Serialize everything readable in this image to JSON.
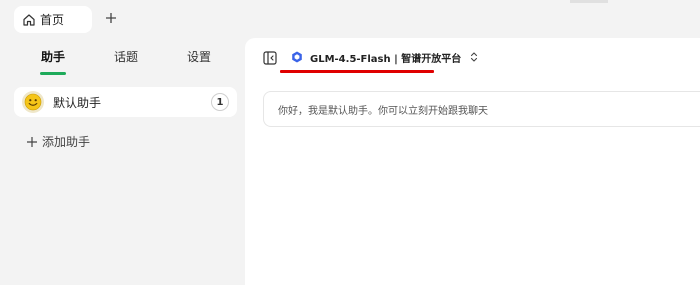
{
  "tabs": [
    {
      "label": "首页",
      "icon": "home-icon",
      "active": true
    }
  ],
  "new_tab_icon": "plus-icon",
  "sidebar": {
    "tabs": [
      {
        "label": "助手",
        "active": true
      },
      {
        "label": "话题",
        "active": false
      },
      {
        "label": "设置",
        "active": false
      }
    ],
    "accent_color": "#1eaa5a",
    "assistants": [
      {
        "name": "默认助手",
        "avatar": "smiley-emoji",
        "count": "1"
      }
    ],
    "add_assistant_label": "添加助手"
  },
  "main": {
    "collapse_icon": "sidebar-collapse-icon",
    "model": {
      "label": "GLM-4.5-Flash | 智谱开放平台",
      "icon": "model-provider-icon",
      "chevron": "chevron-updown-icon",
      "annotation_color": "#e00000"
    },
    "greeting": "你好，我是默认助手。你可以立刻开始跟我聊天"
  }
}
